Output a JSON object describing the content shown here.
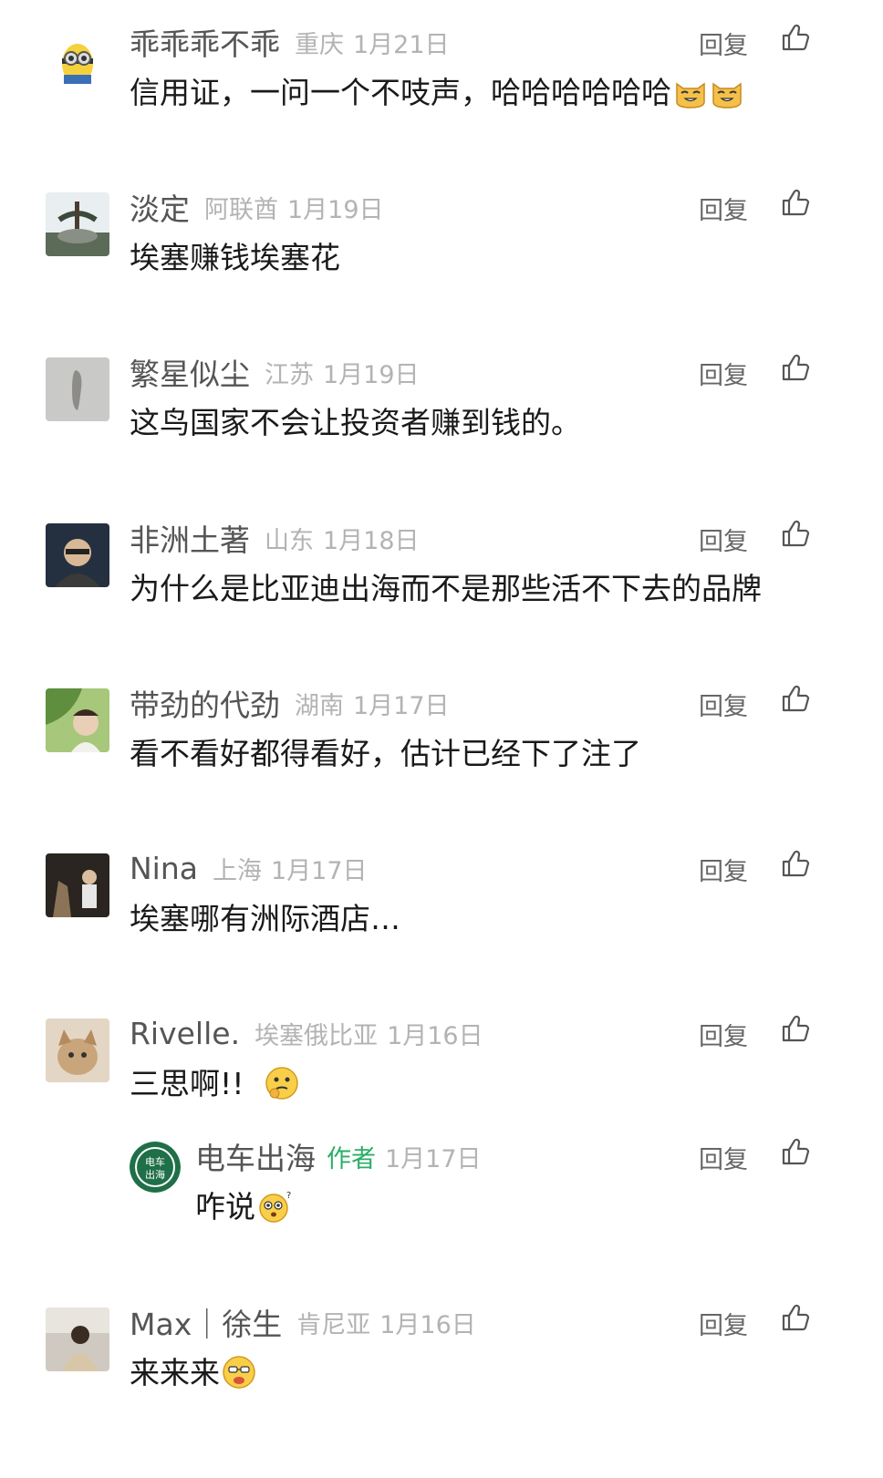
{
  "actions": {
    "reply_label": "回复",
    "like_icon": "thumbs-up-icon"
  },
  "comments": [
    {
      "nickname": "乖乖乖不乖",
      "location": "重庆",
      "date": "1月21日",
      "text": "信用证，一问一个不吱声，哈哈哈哈哈哈",
      "emojis": [
        "cat-laugh-emoji",
        "cat-laugh-emoji"
      ]
    },
    {
      "nickname": "淡定",
      "location": "阿联酋",
      "date": "1月19日",
      "text": "埃塞赚钱埃塞花"
    },
    {
      "nickname": "繁星似尘",
      "location": "江苏",
      "date": "1月19日",
      "text": "这鸟国家不会让投资者赚到钱的。"
    },
    {
      "nickname": "非洲土著",
      "location": "山东",
      "date": "1月18日",
      "text": "为什么是比亚迪出海而不是那些活不下去的品牌"
    },
    {
      "nickname": "带劲的代劲",
      "location": "湖南",
      "date": "1月17日",
      "text": "看不看好都得看好，估计已经下了注了"
    },
    {
      "nickname": "Nina",
      "location": "上海",
      "date": "1月17日",
      "text": "埃塞哪有洲际酒店…"
    },
    {
      "nickname": "Rivelle.",
      "location": "埃塞俄比亚",
      "date": "1月16日",
      "text": "三思啊!!  ",
      "emojis": [
        "thinking-emoji"
      ]
    },
    {
      "nickname": "Max｜徐生",
      "location": "肯尼亚",
      "date": "1月16日",
      "text": "来来来",
      "emojis": [
        "puzzled-emoji"
      ]
    }
  ],
  "reply": {
    "nickname": "电车出海",
    "author_tag": "作者",
    "date": "1月17日",
    "text": "咋说",
    "avatar_text": "电车出海",
    "emojis": [
      "question-emoji"
    ]
  }
}
